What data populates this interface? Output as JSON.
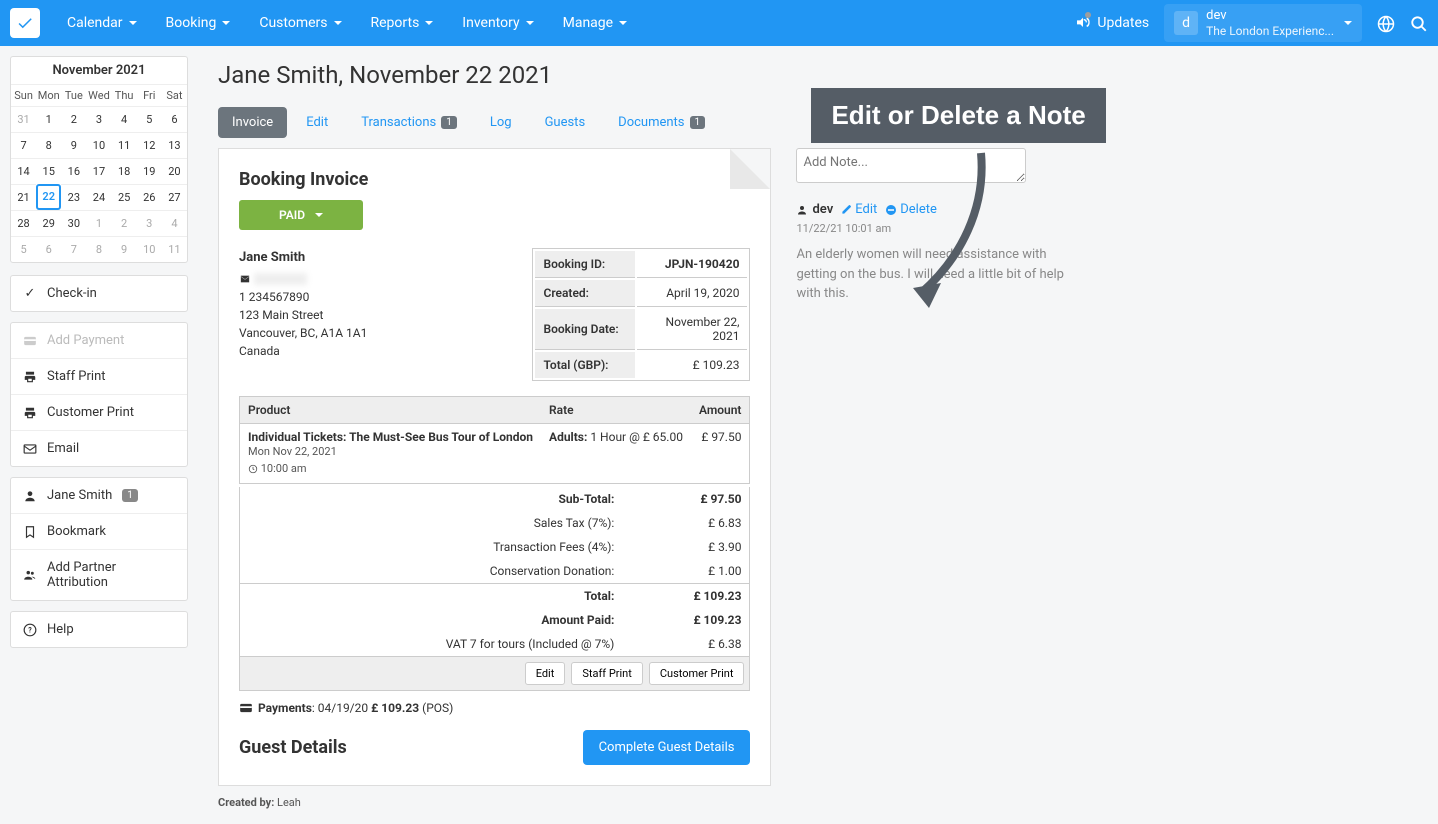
{
  "nav": {
    "calendar": "Calendar",
    "booking": "Booking",
    "customers": "Customers",
    "reports": "Reports",
    "inventory": "Inventory",
    "manage": "Manage"
  },
  "updates": "Updates",
  "user": {
    "initial": "d",
    "name": "dev",
    "org": "The London Experienc..."
  },
  "calendar": {
    "title": "November 2021",
    "dow": [
      "Sun",
      "Mon",
      "Tue",
      "Wed",
      "Thu",
      "Fri",
      "Sat"
    ],
    "days": [
      {
        "d": "31",
        "dim": true
      },
      {
        "d": "1"
      },
      {
        "d": "2"
      },
      {
        "d": "3"
      },
      {
        "d": "4"
      },
      {
        "d": "5"
      },
      {
        "d": "6"
      },
      {
        "d": "7"
      },
      {
        "d": "8"
      },
      {
        "d": "9"
      },
      {
        "d": "10"
      },
      {
        "d": "11"
      },
      {
        "d": "12"
      },
      {
        "d": "13"
      },
      {
        "d": "14"
      },
      {
        "d": "15"
      },
      {
        "d": "16"
      },
      {
        "d": "17"
      },
      {
        "d": "18"
      },
      {
        "d": "19"
      },
      {
        "d": "20"
      },
      {
        "d": "21"
      },
      {
        "d": "22",
        "sel": true
      },
      {
        "d": "23"
      },
      {
        "d": "24"
      },
      {
        "d": "25"
      },
      {
        "d": "26"
      },
      {
        "d": "27"
      },
      {
        "d": "28"
      },
      {
        "d": "29"
      },
      {
        "d": "30"
      },
      {
        "d": "1",
        "dim": true
      },
      {
        "d": "2",
        "dim": true
      },
      {
        "d": "3",
        "dim": true
      },
      {
        "d": "4",
        "dim": true
      },
      {
        "d": "5",
        "dim": true
      },
      {
        "d": "6",
        "dim": true
      },
      {
        "d": "7",
        "dim": true
      },
      {
        "d": "8",
        "dim": true
      },
      {
        "d": "9",
        "dim": true
      },
      {
        "d": "10",
        "dim": true
      },
      {
        "d": "11",
        "dim": true
      }
    ]
  },
  "side": {
    "checkin": "Check-in",
    "add_payment": "Add Payment",
    "staff_print": "Staff Print",
    "customer_print": "Customer Print",
    "email": "Email",
    "customer": "Jane Smith",
    "customer_badge": "1",
    "bookmark": "Bookmark",
    "partner": "Add Partner Attribution",
    "help": "Help"
  },
  "page_title": "Jane Smith, November 22 2021",
  "tabs": {
    "invoice": "Invoice",
    "edit": "Edit",
    "transactions": "Transactions",
    "trans_badge": "1",
    "log": "Log",
    "guests": "Guests",
    "documents": "Documents",
    "docs_badge": "1"
  },
  "invoice": {
    "title": "Booking Invoice",
    "paid": "PAID",
    "customer": {
      "name": "Jane Smith",
      "phone": "1 234567890",
      "addr1": "123 Main Street",
      "addr2": "Vancouver, BC, A1A 1A1",
      "addr3": "Canada"
    },
    "meta": {
      "id_label": "Booking ID:",
      "id": "JPJN-190420",
      "created_label": "Created:",
      "created": "April 19, 2020",
      "date_label": "Booking Date:",
      "date": "November 22, 2021",
      "total_label": "Total (GBP):",
      "total": "£ 109.23"
    },
    "headers": {
      "product": "Product",
      "rate": "Rate",
      "amount": "Amount"
    },
    "line": {
      "name": "Individual Tickets: The Must-See Bus Tour of London",
      "date": "Mon Nov 22, 2021",
      "time": "10:00 am",
      "rate_label": "Adults:",
      "rate": " 1 Hour @ £ 65.00",
      "amount": "£ 97.50"
    },
    "totals": {
      "subtotal_l": "Sub-Total:",
      "subtotal": "£ 97.50",
      "tax_l": "Sales Tax (7%):",
      "tax": "£ 6.83",
      "fees_l": "Transaction Fees (4%):",
      "fees": "£ 3.90",
      "donation_l": "Conservation Donation:",
      "donation": "£ 1.00",
      "total_l": "Total:",
      "total": "£ 109.23",
      "paid_l": "Amount Paid:",
      "paid": "£ 109.23",
      "vat_l": "VAT 7 for tours (Included @ 7%)",
      "vat": "£ 6.38"
    },
    "buttons": {
      "edit": "Edit",
      "staff": "Staff Print",
      "cust": "Customer Print"
    },
    "payments": {
      "label": "Payments",
      "date": ": 04/19/20 ",
      "amount": "£ 109.23",
      "method": " (POS)"
    },
    "guest_title": "Guest Details",
    "guest_btn": "Complete Guest Details"
  },
  "created_by": {
    "label": "Created by: ",
    "name": "Leah"
  },
  "callout": "Edit or Delete a Note",
  "note": {
    "placeholder": "Add Note...",
    "author": "dev",
    "edit": "Edit",
    "delete": "Delete",
    "date": "11/22/21 10:01 am",
    "body": "An elderly women will need assistance with getting on the bus. I will need a little bit of help with this."
  }
}
